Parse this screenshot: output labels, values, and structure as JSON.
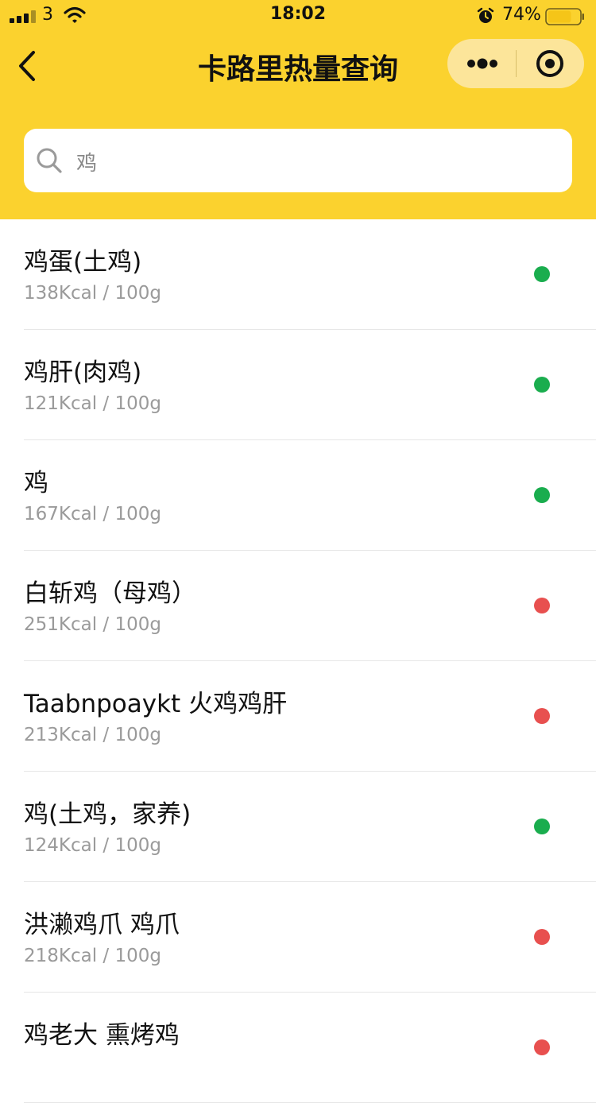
{
  "status_bar": {
    "carrier": "3",
    "time": "18:02",
    "battery_percent": "74%",
    "battery_level": 0.74,
    "icons": [
      "signal-icon",
      "wifi-icon",
      "alarm-icon",
      "battery-icon"
    ]
  },
  "nav": {
    "title": "卡路里热量查询",
    "icons": [
      "back-icon",
      "more-icon",
      "close-icon"
    ]
  },
  "search": {
    "value": "鸡",
    "icon": "search-icon"
  },
  "colors": {
    "header_bg": "#fbd22e",
    "good": "#1aad4e",
    "bad": "#e8504f"
  },
  "items": [
    {
      "name": "鸡蛋(土鸡)",
      "kcal": "138Kcal",
      "unit": "100g",
      "status": "good"
    },
    {
      "name": "鸡肝(肉鸡)",
      "kcal": "121Kcal",
      "unit": "100g",
      "status": "good"
    },
    {
      "name": "鸡",
      "kcal": "167Kcal",
      "unit": "100g",
      "status": "good"
    },
    {
      "name": "白斩鸡（母鸡）",
      "kcal": "251Kcal",
      "unit": "100g",
      "status": "bad"
    },
    {
      "name": "Taabnpoaykt 火鸡鸡肝",
      "kcal": "213Kcal",
      "unit": "100g",
      "status": "bad"
    },
    {
      "name": "鸡(土鸡，家养)",
      "kcal": "124Kcal",
      "unit": "100g",
      "status": "good"
    },
    {
      "name": "洪濑鸡爪 鸡爪",
      "kcal": "218Kcal",
      "unit": "100g",
      "status": "bad"
    },
    {
      "name": "鸡老大 熏烤鸡",
      "kcal": "",
      "unit": "",
      "status": "bad"
    }
  ]
}
